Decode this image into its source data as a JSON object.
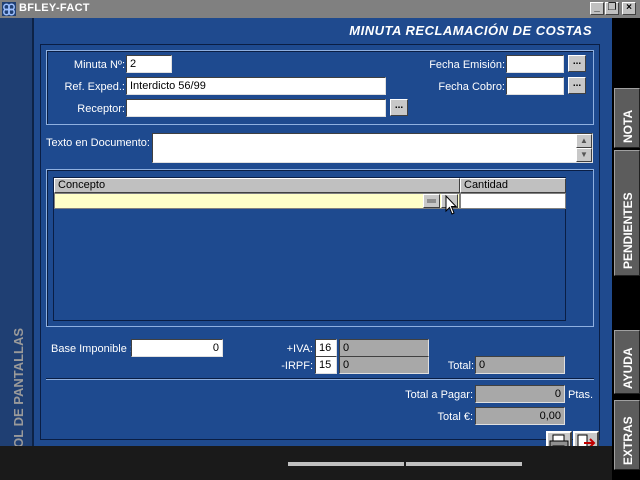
{
  "window": {
    "title": "BFLEY-FACT",
    "minimize": "_",
    "restore": "❐",
    "close": "×"
  },
  "form": {
    "header_title": "MINUTA RECLAMACIÓN DE COSTAS",
    "minuta_label": "Minuta Nº:",
    "minuta_value": "2",
    "ref_label": "Ref. Exped.:",
    "ref_value": "Interdicto 56/99",
    "receptor_label": "Receptor:",
    "receptor_value": "",
    "fecha_emision_label": "Fecha Emisión:",
    "fecha_emision_value": "",
    "fecha_cobro_label": "Fecha Cobro:",
    "fecha_cobro_value": "",
    "texto_label": "Texto en Documento:",
    "texto_value": "",
    "dots": "...",
    "grid": {
      "col_concepto": "Concepto",
      "col_cantidad": "Cantidad"
    },
    "base_label": "Base Imponible :",
    "base_value": "0",
    "iva_label": "+IVA:",
    "iva_rate": "16",
    "iva_value": "0",
    "irpf_label": "-IRPF:",
    "irpf_rate": "15",
    "irpf_value": "0",
    "total_label": "Total:",
    "total_value": "0",
    "total_pagar_label": "Total a Pagar:",
    "total_pagar_value": "0",
    "total_pagar_unit": "Ptas.",
    "total_euro_label": "Total €:",
    "total_euro_value": "0,00"
  },
  "left_panel": {
    "label": "ARBOL DE PANTALLAS"
  },
  "right_tabs": [
    {
      "label": "NOTA"
    },
    {
      "label": "PENDIENTES"
    },
    {
      "label": "AYUDA"
    },
    {
      "label": "EXTRAS"
    }
  ],
  "colors": {
    "panel": "#1f4a8e",
    "highlight_row": "#ffffc8",
    "sidebar": "#5c5c5c"
  }
}
